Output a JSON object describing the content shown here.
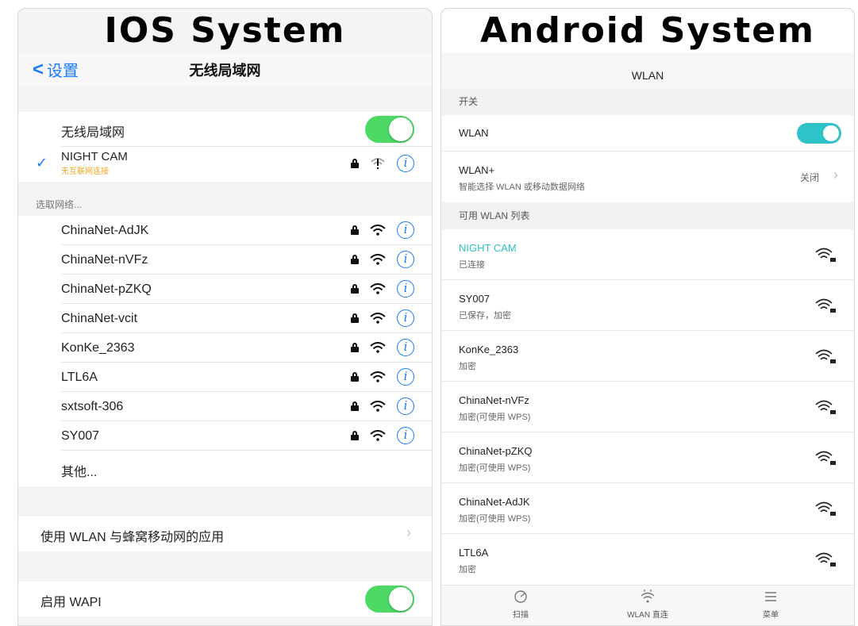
{
  "ios": {
    "heading": "IOS System",
    "nav": {
      "back_label": "设置",
      "title": "无线局域网"
    },
    "wifi_toggle_label": "无线局域网",
    "connected": {
      "name": "NIGHT CAM",
      "status": "无互联网连接"
    },
    "choose_header": "选取网络...",
    "networks": [
      {
        "name": "ChinaNet-AdJK"
      },
      {
        "name": "ChinaNet-nVFz"
      },
      {
        "name": "ChinaNet-pZKQ"
      },
      {
        "name": "ChinaNet-vcit"
      },
      {
        "name": "KonKe_2363"
      },
      {
        "name": "LTL6A"
      },
      {
        "name": "sxtsoft-306"
      },
      {
        "name": "SY007"
      }
    ],
    "other_label": "其他...",
    "apps_label": "使用 WLAN 与蜂窝移动网的应用",
    "wapi_label": "启用 WAPI",
    "info_glyph": "i",
    "chevron_glyph": "›",
    "check_glyph": "✓",
    "back_glyph": "<"
  },
  "android": {
    "heading": "Android System",
    "nav_title": "WLAN",
    "switch_header": "开关",
    "wlan_label": "WLAN",
    "wlan_plus": {
      "title": "WLAN+",
      "subtitle": "智能选择 WLAN 或移动数据网络",
      "value": "关闭"
    },
    "list_header": "可用 WLAN 列表",
    "networks": [
      {
        "name": "NIGHT CAM",
        "status": "已连接",
        "highlight": true
      },
      {
        "name": "SY007",
        "status": "已保存，加密",
        "highlight": false
      },
      {
        "name": "KonKe_2363",
        "status": "加密",
        "highlight": false
      },
      {
        "name": "ChinaNet-nVFz",
        "status": "加密(可使用 WPS)",
        "highlight": false
      },
      {
        "name": "ChinaNet-pZKQ",
        "status": "加密(可使用 WPS)",
        "highlight": false
      },
      {
        "name": "ChinaNet-AdJK",
        "status": "加密(可使用 WPS)",
        "highlight": false
      },
      {
        "name": "LTL6A",
        "status": "加密",
        "highlight": false
      }
    ],
    "bottom_tabs": [
      {
        "label": "扫描",
        "icon": "scan-icon"
      },
      {
        "label": "WLAN 直连",
        "icon": "wifi-direct-icon"
      },
      {
        "label": "菜单",
        "icon": "menu-icon"
      }
    ],
    "chevron_glyph": "›"
  },
  "colors": {
    "ios_blue": "#1a7cf5",
    "ios_green": "#4cd964",
    "android_teal": "#2ec2c9",
    "ios_warning": "#f5a623"
  }
}
